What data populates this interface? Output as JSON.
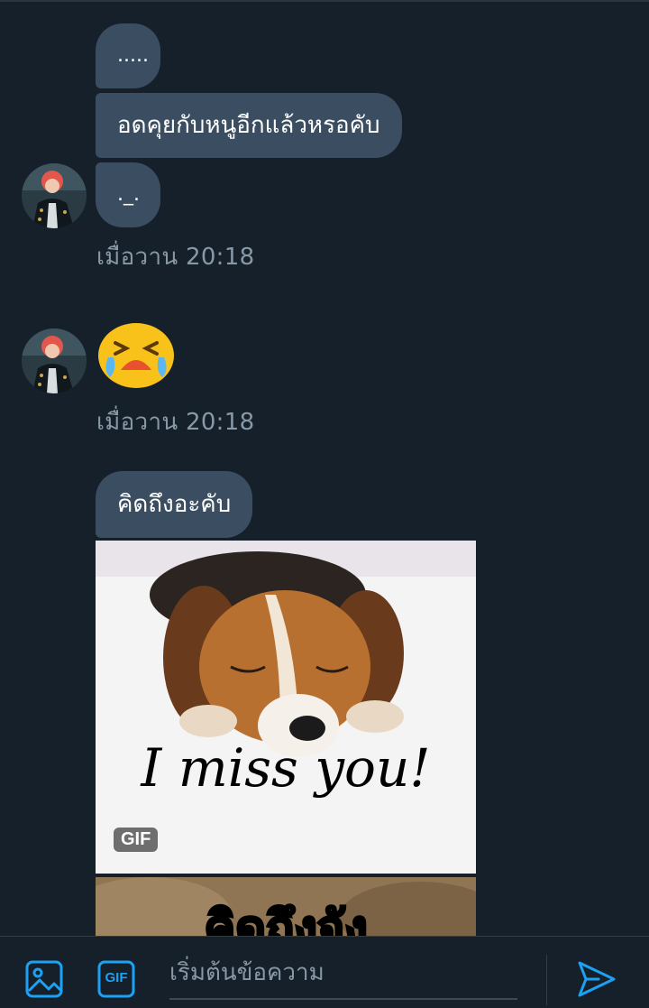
{
  "conversation": {
    "messages": [
      {
        "text": "....."
      },
      {
        "text": "อดคุยกับหนูอีกแล้วหรอคับ"
      },
      {
        "text": "._."
      }
    ],
    "group1_time": "เมื่อวาน  20:18",
    "emoji_message": {
      "icon": "crying-face-emoji"
    },
    "group2_time": "เมื่อวาน  20:18",
    "text_message_3": "คิดถึงอะคับ",
    "gif1": {
      "caption": "I miss you!",
      "badge": "GIF"
    },
    "gif2": {
      "caption": "คิดถึงจัง"
    }
  },
  "composer": {
    "placeholder": "เริ่มต้นข้อความ",
    "gif_button_label": "GIF",
    "icons": [
      "image-icon",
      "gif-icon",
      "send-icon"
    ]
  },
  "colors": {
    "background": "#15202b",
    "bubble": "#3b4e61",
    "secondary_text": "#8899a6",
    "accent": "#1da1f2"
  }
}
